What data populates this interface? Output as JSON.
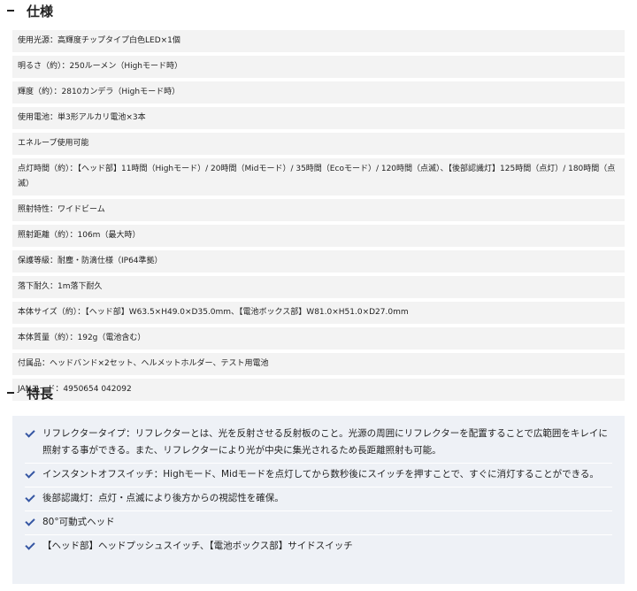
{
  "spec": {
    "title": "仕様",
    "rows": [
      "使用光源：高輝度チップタイプ白色LED×1個",
      "明るさ（約）：250ルーメン（Highモード時）",
      "輝度（約）：2810カンデラ（Highモード時）",
      "使用電池：単3形アルカリ電池×3本",
      "エネループ使用可能",
      "点灯時間（約）：【ヘッド部】11時間（Highモード）/ 20時間（Midモード）/ 35時間（Ecoモード）/ 120時間（点滅）、【後部認識灯】125時間（点灯）/ 180時間（点滅）",
      "照射特性：ワイドビーム",
      "照射距離（約）：106m（最大時）",
      "保護等級：耐塵・防滴仕様（IP64準拠）",
      "落下耐久：1m落下耐久",
      "本体サイズ（約）：【ヘッド部】W63.5×H49.0×D35.0mm、【電池ボックス部】W81.0×H51.0×D27.0mm",
      "本体質量（約）：192g（電池含む）",
      "付属品：ヘッドバンド×2セット、ヘルメットホルダー、テスト用電池",
      "JANコード：4950654 042092"
    ]
  },
  "features": {
    "title": "特長",
    "icon": "check-icon",
    "accent": "#3556a3",
    "items": [
      "リフレクタータイプ：リフレクターとは、光を反射させる反射板のこと。光源の周囲にリフレクターを配置することで広範囲をキレイに照射する事ができる。また、リフレクターにより光が中央に集光されるため長距離照射も可能。",
      "インスタントオフスイッチ：Highモード、Midモードを点灯してから数秒後にスイッチを押すことで、すぐに消灯することができる。",
      "後部認識灯：点灯・点滅により後方からの視認性を確保。",
      "80°可動式ヘッド",
      "【ヘッド部】ヘッドプッシュスイッチ、【電池ボックス部】サイドスイッチ"
    ]
  }
}
